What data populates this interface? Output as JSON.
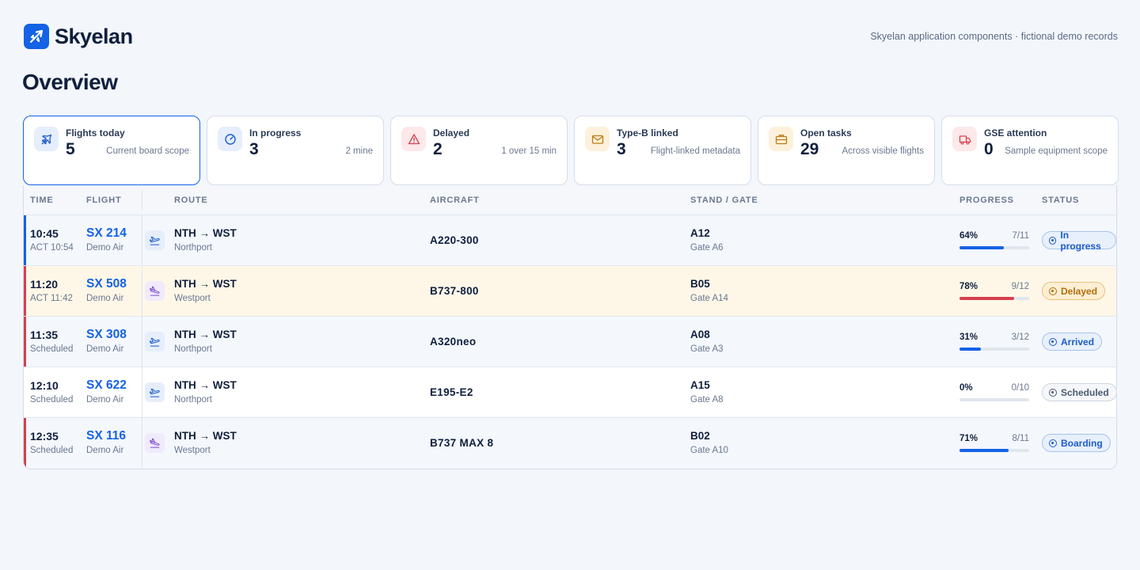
{
  "app": {
    "name": "Skyelan",
    "note": "Skyelan application components · fictional demo records"
  },
  "page": {
    "title": "Overview"
  },
  "cards": [
    {
      "label": "Flights today",
      "value": "5",
      "sub": "Current board scope",
      "icon": "plane-icon"
    },
    {
      "label": "In progress",
      "value": "3",
      "sub": "2 mine",
      "icon": "gauge-icon"
    },
    {
      "label": "Delayed",
      "value": "2",
      "sub": "1 over 15 min",
      "icon": "warning-icon"
    },
    {
      "label": "Type-B linked",
      "value": "3",
      "sub": "Flight-linked metadata",
      "icon": "mail-icon"
    },
    {
      "label": "Open tasks",
      "value": "29",
      "sub": "Across visible flights",
      "icon": "briefcase-icon"
    },
    {
      "label": "GSE attention",
      "value": "0",
      "sub": "Sample equipment scope",
      "icon": "truck-icon"
    }
  ],
  "table": {
    "headers": {
      "time": "TIME",
      "flight": "FLIGHT",
      "route": "ROUTE",
      "aircraft": "AIRCRAFT",
      "stand": "STAND / GATE",
      "progress": "PROGRESS",
      "status": "STATUS"
    },
    "rows": [
      {
        "time": "10:45",
        "time_sub": "ACT 10:54",
        "flight": "SX 214",
        "airline": "Demo Air",
        "route": "NTH → WST",
        "route_sub": "Northport",
        "direction": "departure",
        "aircraft": "A220-300",
        "stand": "A12",
        "gate": "Gate A6",
        "progress_pct": 64,
        "progress_label": "64%",
        "progress_count": "7/11",
        "status": "In progress"
      },
      {
        "time": "11:20",
        "time_sub": "ACT 11:42",
        "flight": "SX 508",
        "airline": "Demo Air",
        "route": "NTH → WST",
        "route_sub": "Westport",
        "direction": "arrival",
        "aircraft": "B737-800",
        "stand": "B05",
        "gate": "Gate A14",
        "progress_pct": 78,
        "progress_label": "78%",
        "progress_count": "9/12",
        "status": "Delayed"
      },
      {
        "time": "11:35",
        "time_sub": "Scheduled",
        "flight": "SX 308",
        "airline": "Demo Air",
        "route": "NTH → WST",
        "route_sub": "Northport",
        "direction": "departure",
        "aircraft": "A320neo",
        "stand": "A08",
        "gate": "Gate A3",
        "progress_pct": 31,
        "progress_label": "31%",
        "progress_count": "3/12",
        "status": "Arrived"
      },
      {
        "time": "12:10",
        "time_sub": "Scheduled",
        "flight": "SX 622",
        "airline": "Demo Air",
        "route": "NTH → WST",
        "route_sub": "Northport",
        "direction": "departure",
        "aircraft": "E195-E2",
        "stand": "A15",
        "gate": "Gate A8",
        "progress_pct": 0,
        "progress_label": "0%",
        "progress_count": "0/10",
        "status": "Scheduled"
      },
      {
        "time": "12:35",
        "time_sub": "Scheduled",
        "flight": "SX 116",
        "airline": "Demo Air",
        "route": "NTH → WST",
        "route_sub": "Westport",
        "direction": "arrival",
        "aircraft": "B737 MAX 8",
        "stand": "B02",
        "gate": "Gate A10",
        "progress_pct": 71,
        "progress_label": "71%",
        "progress_count": "8/11",
        "status": "Boarding"
      }
    ]
  },
  "colors": {
    "accent": "#1462e6",
    "danger": "#d6404f",
    "warning": "#b06d0a",
    "background": "#f3f6fb"
  }
}
